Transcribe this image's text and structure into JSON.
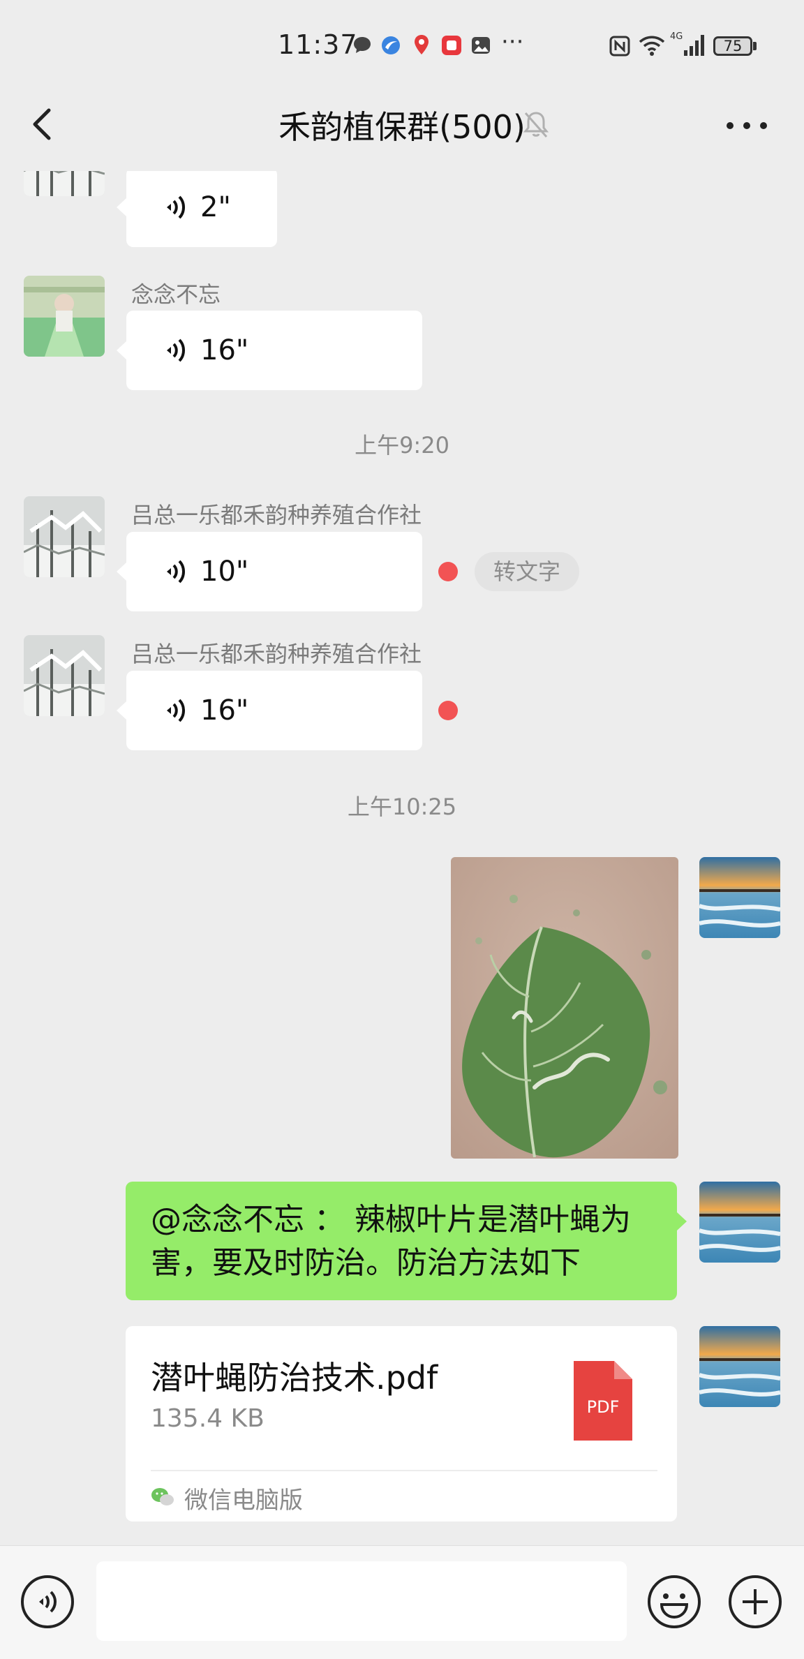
{
  "status_bar": {
    "time": "11:37",
    "notification_icons": [
      "chat-bubble-icon",
      "browser-icon",
      "map-pin-icon",
      "red-app-icon",
      "gallery-icon"
    ],
    "more_dots": "···",
    "right_icons": [
      "nfc-icon",
      "wifi-icon",
      "4g-signal-icon"
    ],
    "battery": "75"
  },
  "nav": {
    "title": "禾韵植保群(500)",
    "muted": true
  },
  "messages": {
    "m1": {
      "duration": "2\""
    },
    "m2": {
      "sender": "念念不忘",
      "duration": "16\""
    },
    "time1": "上午9:20",
    "m3": {
      "sender": "吕总一乐都禾韵种养殖合作社",
      "duration": "10\"",
      "convert_label": "转文字"
    },
    "m4": {
      "sender": "吕总一乐都禾韵种养殖合作社",
      "duration": "16\""
    },
    "time2": "上午10:25",
    "m6": {
      "text": "@念念不忘 ： 辣椒叶片是潜叶蝇为害，要及时防治。防治方法如下"
    },
    "m7": {
      "file_name": "潜叶蝇防治技术.pdf",
      "file_size": "135.4 KB",
      "file_type": "PDF",
      "source": "微信电脑版"
    }
  },
  "colors": {
    "background": "#ededed",
    "sent_bubble": "#95ec69",
    "received_bubble": "#ffffff",
    "unread_dot": "#f25354",
    "pdf_red": "#e64340"
  }
}
